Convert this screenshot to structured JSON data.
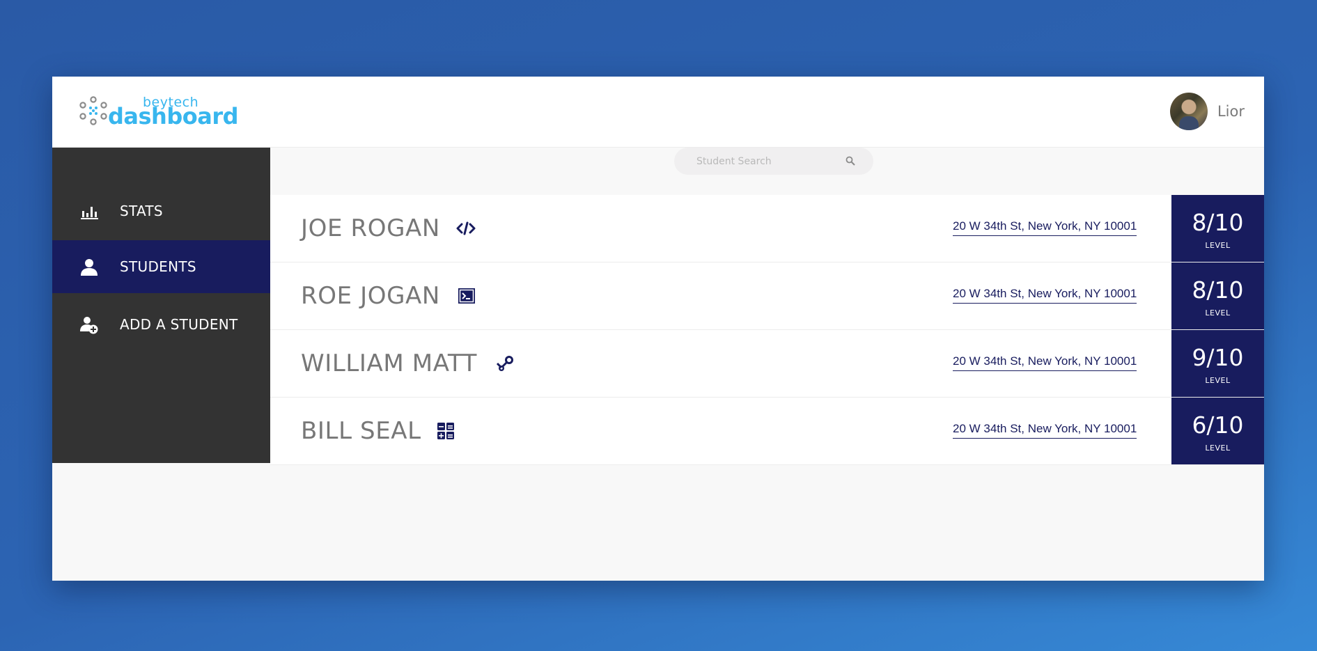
{
  "brand": {
    "small": "beytech",
    "big": "dashboard",
    "color": "#38b6ee"
  },
  "user": {
    "name": "Lior"
  },
  "sidebar": {
    "items": [
      {
        "label": "STATS",
        "icon": "bar-chart-icon",
        "active": false
      },
      {
        "label": "STUDENTS",
        "icon": "person-icon",
        "active": true
      },
      {
        "label": "ADD A STUDENT",
        "icon": "add-person-icon",
        "active": false
      }
    ]
  },
  "search": {
    "placeholder": "Student Search",
    "value": ""
  },
  "students": [
    {
      "name": "JOE ROGAN",
      "icon": "code-icon",
      "address": "20 W 34th St, New York, NY 10001",
      "level": "8/10",
      "level_label": "LEVEL"
    },
    {
      "name": "ROE JOGAN",
      "icon": "terminal-icon",
      "address": "20 W 34th St, New York, NY 10001",
      "level": "8/10",
      "level_label": "LEVEL"
    },
    {
      "name": "WILLIAM MATT",
      "icon": "steam-icon",
      "address": "20 W 34th St, New York, NY 10001",
      "level": "9/10",
      "level_label": "LEVEL"
    },
    {
      "name": "BILL SEAL",
      "icon": "calculator-icon",
      "address": "20 W 34th St, New York, NY 10001",
      "level": "6/10",
      "level_label": "LEVEL"
    }
  ],
  "colors": {
    "navy": "#181c5e",
    "sidebar": "#333333",
    "accent": "#38b6ee"
  }
}
